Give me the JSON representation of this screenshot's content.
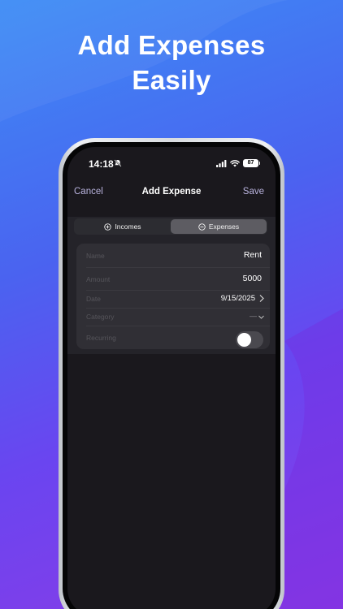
{
  "headline": {
    "line1": "Add Expenses",
    "line2": "Easily"
  },
  "status_bar": {
    "time": "14:18",
    "battery": "87"
  },
  "nav": {
    "cancel": "Cancel",
    "title": "Add Expense",
    "save": "Save"
  },
  "segments": [
    {
      "label": "Incomes",
      "icon": "plus-circle-icon",
      "selected": false
    },
    {
      "label": "Expenses",
      "icon": "minus-circle-icon",
      "selected": true
    }
  ],
  "form": {
    "name": {
      "label": "Name",
      "value": "Rent"
    },
    "amount": {
      "label": "Amount",
      "value": "5000"
    },
    "date": {
      "label": "Date",
      "value": "9/15/2025"
    },
    "category": {
      "label": "Category",
      "value": "—"
    },
    "recurring": {
      "label": "Recurring",
      "on": false
    }
  },
  "colors": {
    "accent": "#b9b3de",
    "screen_bg": "#1a181d",
    "card_bg": "#302f35"
  }
}
